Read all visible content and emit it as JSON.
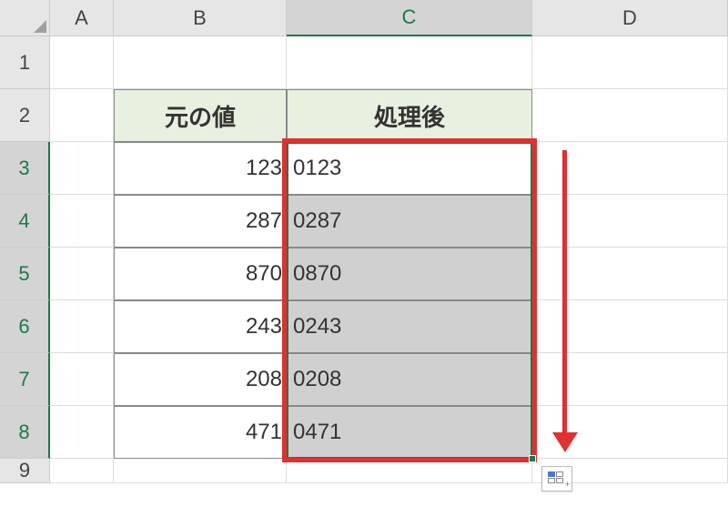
{
  "columns": {
    "A": "A",
    "B": "B",
    "C": "C",
    "D": "D"
  },
  "rows": [
    "1",
    "2",
    "3",
    "4",
    "5",
    "6",
    "7",
    "8",
    "9"
  ],
  "headers": {
    "original": "元の値",
    "processed": "処理後"
  },
  "data": [
    {
      "original": "123",
      "processed": "0123"
    },
    {
      "original": "287",
      "processed": "0287"
    },
    {
      "original": "870",
      "processed": "0870"
    },
    {
      "original": "243",
      "processed": "0243"
    },
    {
      "original": "208",
      "processed": "0208"
    },
    {
      "original": "471",
      "processed": "0471"
    }
  ]
}
